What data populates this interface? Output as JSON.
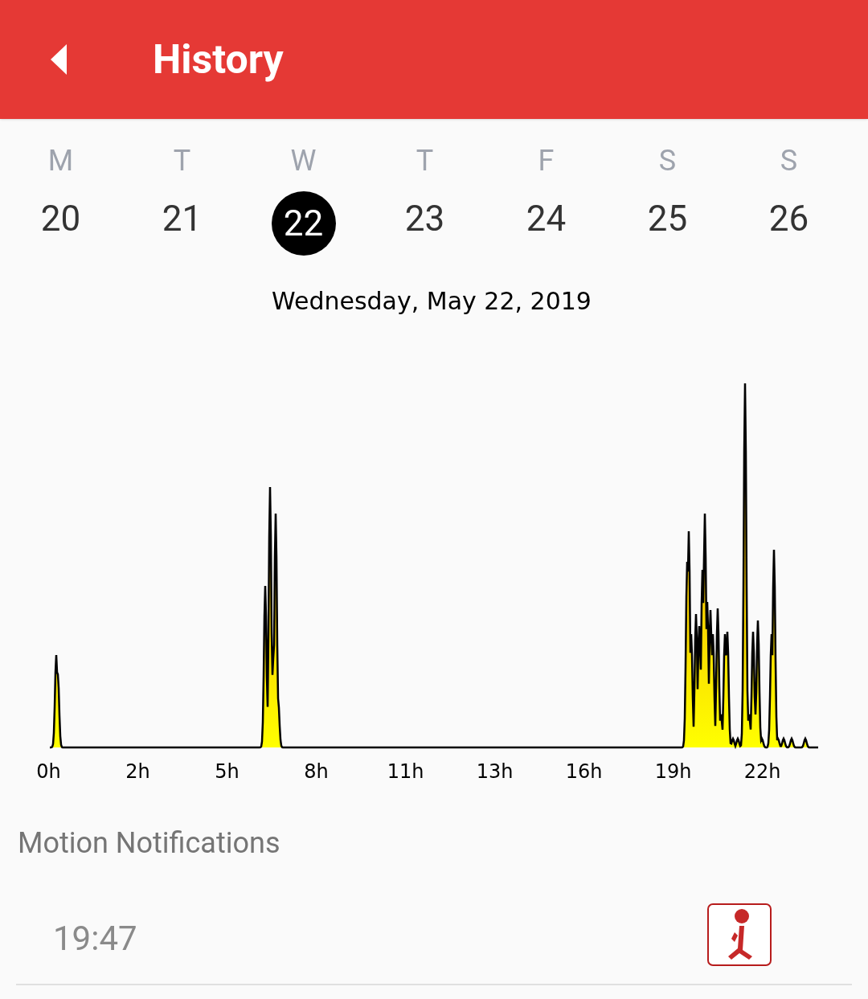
{
  "app_bar": {
    "title": "History"
  },
  "week": [
    {
      "weekday": "M",
      "day": "20",
      "selected": false
    },
    {
      "weekday": "T",
      "day": "21",
      "selected": false
    },
    {
      "weekday": "W",
      "day": "22",
      "selected": true
    },
    {
      "weekday": "T",
      "day": "23",
      "selected": false
    },
    {
      "weekday": "F",
      "day": "24",
      "selected": false
    },
    {
      "weekday": "S",
      "day": "25",
      "selected": false
    },
    {
      "weekday": "S",
      "day": "26",
      "selected": false
    }
  ],
  "date_heading": "Wednesday, May 22, 2019",
  "activity_chart": {
    "x_labels": [
      "0h",
      "2h",
      "5h",
      "8h",
      "11h",
      "13h",
      "16h",
      "19h",
      "22h"
    ]
  },
  "section_title": "Motion Notifications",
  "notifications": [
    {
      "time": "19:47"
    }
  ]
}
